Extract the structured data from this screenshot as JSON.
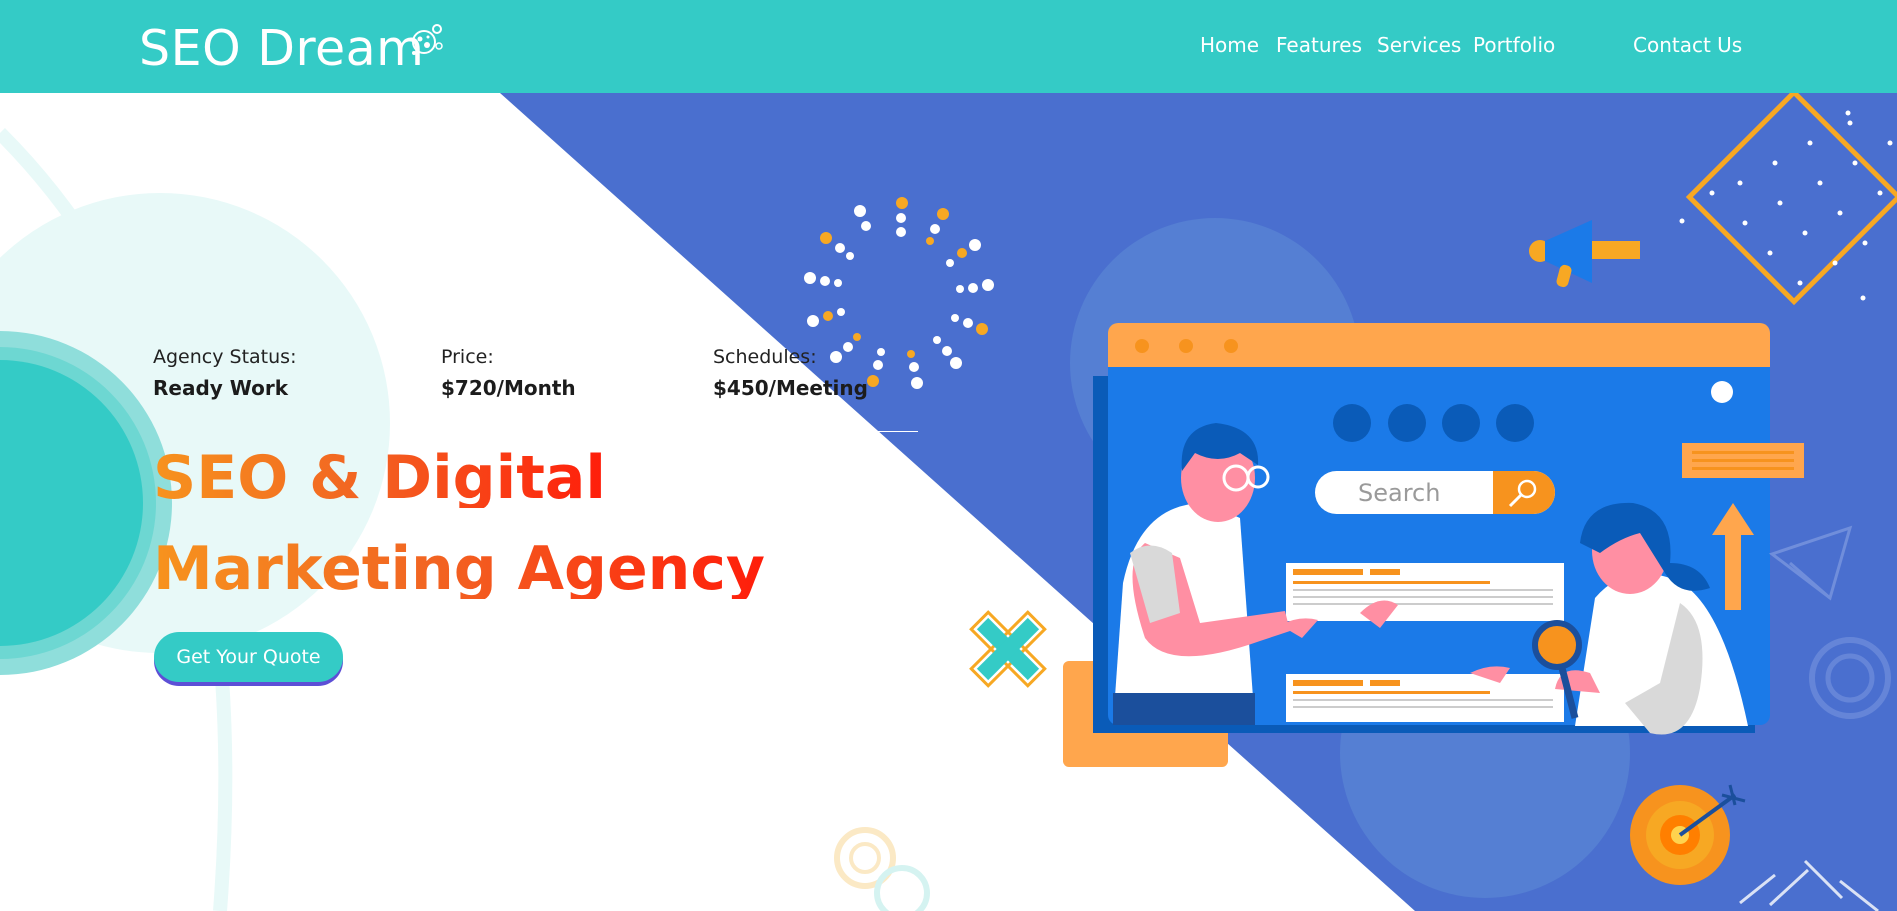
{
  "brand": {
    "name": "SEO Dream"
  },
  "nav": {
    "items": [
      {
        "label": "Home"
      },
      {
        "label": "Features"
      },
      {
        "label": "Services"
      },
      {
        "label": "Portfolio"
      },
      {
        "label": "Contact Us"
      }
    ]
  },
  "hero": {
    "stats": [
      {
        "label": "Agency Status:",
        "value": "Ready Work"
      },
      {
        "label": "Price:",
        "value": "$720/Month"
      },
      {
        "label": "Schedules:",
        "value": "$450/Meeting"
      }
    ],
    "headline_line1": "SEO & Digital",
    "headline_line2": "Marketing Agency",
    "cta_label": "Get Your Quote"
  },
  "illustration": {
    "search_placeholder": "Search"
  },
  "colors": {
    "header": "#34cbc6",
    "hero_blue": "#4a6fcf",
    "accent_orange": "#f7931e",
    "cta": "#34cbc6"
  },
  "icons": [
    "logo-icon",
    "megaphone-icon",
    "search-icon",
    "magnifier-icon",
    "target-icon",
    "arrow-up-icon",
    "paper-plane-icon"
  ]
}
